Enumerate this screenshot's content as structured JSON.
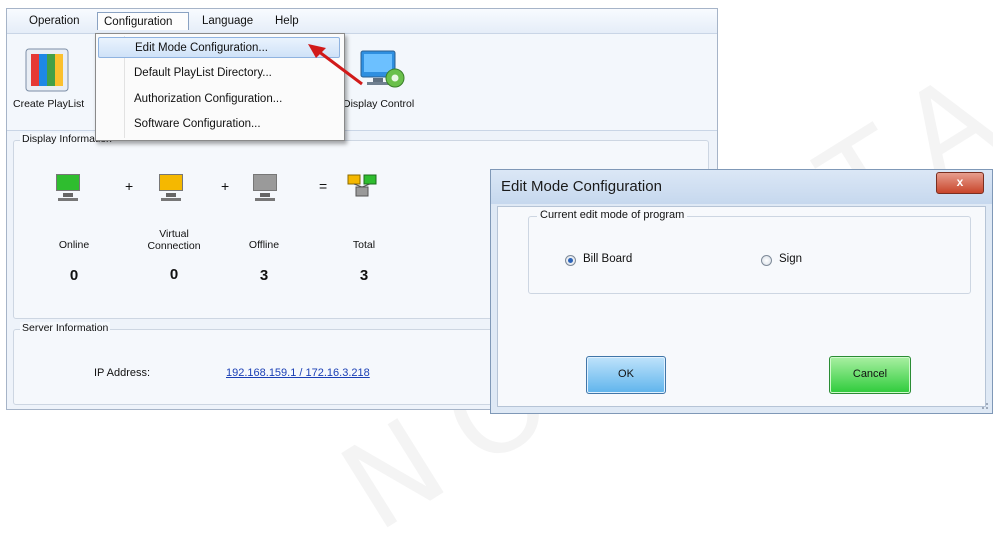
{
  "menubar": {
    "items": [
      "Operation",
      "Configuration",
      "Language",
      "Help"
    ],
    "active": "Configuration"
  },
  "toolbar": {
    "create_playlist": "Create PlayList",
    "display_control": "Display Control"
  },
  "dropdown": {
    "items": [
      "Edit Mode Configuration...",
      "Default PlayList Directory...",
      "Authorization Configuration...",
      "Software Configuration..."
    ],
    "highlighted_index": 0
  },
  "display_info": {
    "title": "Display Information",
    "operators": [
      "+",
      "+",
      "="
    ],
    "statuses": [
      {
        "label": "Online",
        "count": "0",
        "color": "#2fbd2f"
      },
      {
        "label": "Virtual Connection",
        "count": "0",
        "color": "#f5b800"
      },
      {
        "label": "Offline",
        "count": "3",
        "color": "#9a9a9a"
      },
      {
        "label": "Total",
        "count": "3",
        "color": "#66b84a"
      }
    ]
  },
  "server_info": {
    "title": "Server Information",
    "ip_label": "IP Address:",
    "ip_value": "192.168.159.1 / 172.16.3.218"
  },
  "dialog": {
    "title": "Edit Mode Configuration",
    "close_label": "x",
    "group_title": "Current edit mode of program",
    "options": [
      {
        "label": "Bill Board",
        "selected": true
      },
      {
        "label": "Sign",
        "selected": false
      }
    ],
    "ok_label": "OK",
    "cancel_label": "Cancel"
  },
  "watermark": "NOVASTAR TECH",
  "colors": {
    "accent_arrow": "#d11a1a",
    "link": "#1a3fb5"
  }
}
